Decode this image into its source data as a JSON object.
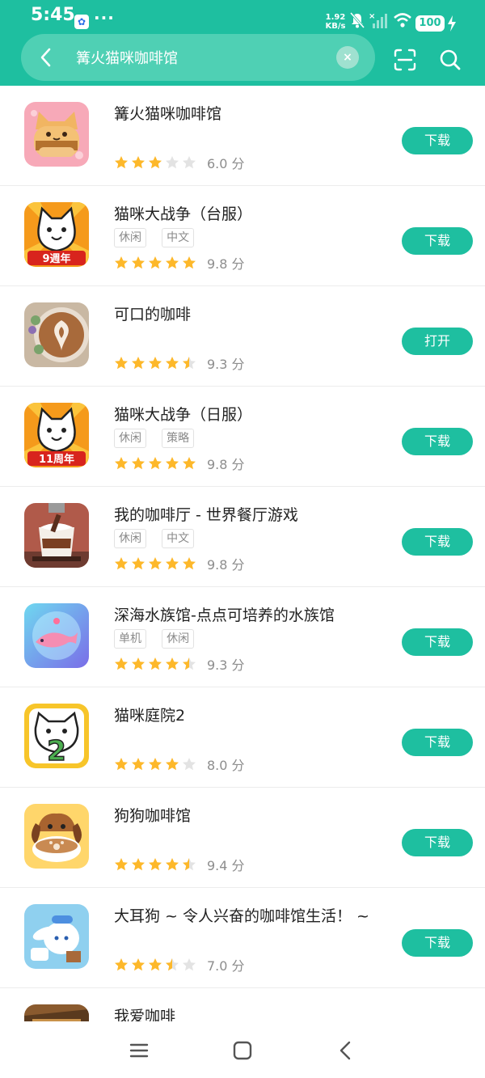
{
  "status_bar": {
    "time": "5:45",
    "baidu_icon": "baidu-paw-icon",
    "dots": "···",
    "net_speed": "1.92",
    "net_unit": "KB/s",
    "battery": "100"
  },
  "search": {
    "query": "篝火猫咪咖啡馆",
    "clear_icon": "×"
  },
  "apps": [
    {
      "name": "篝火猫咪咖啡馆",
      "tags": [],
      "stars": 3,
      "score": "6.0 分",
      "action": "下载",
      "icon": "cat-toast-icon"
    },
    {
      "name": "猫咪大战争（台服）",
      "tags": [
        "休闲",
        "中文"
      ],
      "stars": 5,
      "score": "9.8 分",
      "action": "下载",
      "icon": "battle-cat-9-icon",
      "badge": "9週年"
    },
    {
      "name": "可口的咖啡",
      "tags": [],
      "stars": 4.5,
      "score": "9.3 分",
      "action": "打开",
      "icon": "latte-art-icon"
    },
    {
      "name": "猫咪大战争（日服）",
      "tags": [
        "休闲",
        "策略"
      ],
      "stars": 5,
      "score": "9.8 分",
      "action": "下载",
      "icon": "battle-cat-11-icon",
      "badge": "11周年"
    },
    {
      "name": "我的咖啡厅 - 世界餐厅游戏",
      "tags": [
        "休闲",
        "中文"
      ],
      "stars": 5,
      "score": "9.8 分",
      "action": "下载",
      "icon": "coffee-cup-icon"
    },
    {
      "name": "深海水族馆-点点可培养的水族馆",
      "tags": [
        "单机",
        "休闲"
      ],
      "stars": 4.5,
      "score": "9.3 分",
      "action": "下载",
      "icon": "whale-bubble-icon"
    },
    {
      "name": "猫咪庭院2",
      "tags": [],
      "stars": 4,
      "score": "8.0 分",
      "action": "下载",
      "icon": "cat-two-icon"
    },
    {
      "name": "狗狗咖啡馆",
      "tags": [],
      "stars": 4.5,
      "score": "9.4 分",
      "action": "下载",
      "icon": "dog-coffee-icon"
    },
    {
      "name": "大耳狗 ~ 令人兴奋的咖啡馆生活！ ~",
      "tags": [],
      "stars": 3.5,
      "score": "7.0 分",
      "action": "下载",
      "icon": "cinnamoroll-icon"
    },
    {
      "name": "我爱咖啡",
      "tags": [],
      "stars": 0,
      "score": "",
      "action": "",
      "icon": "coffee-shop-icon",
      "partial": true
    }
  ],
  "colors": {
    "accent": "#1ebfa0",
    "star": "#fdb82a",
    "star_empty": "#e3e3e3"
  }
}
